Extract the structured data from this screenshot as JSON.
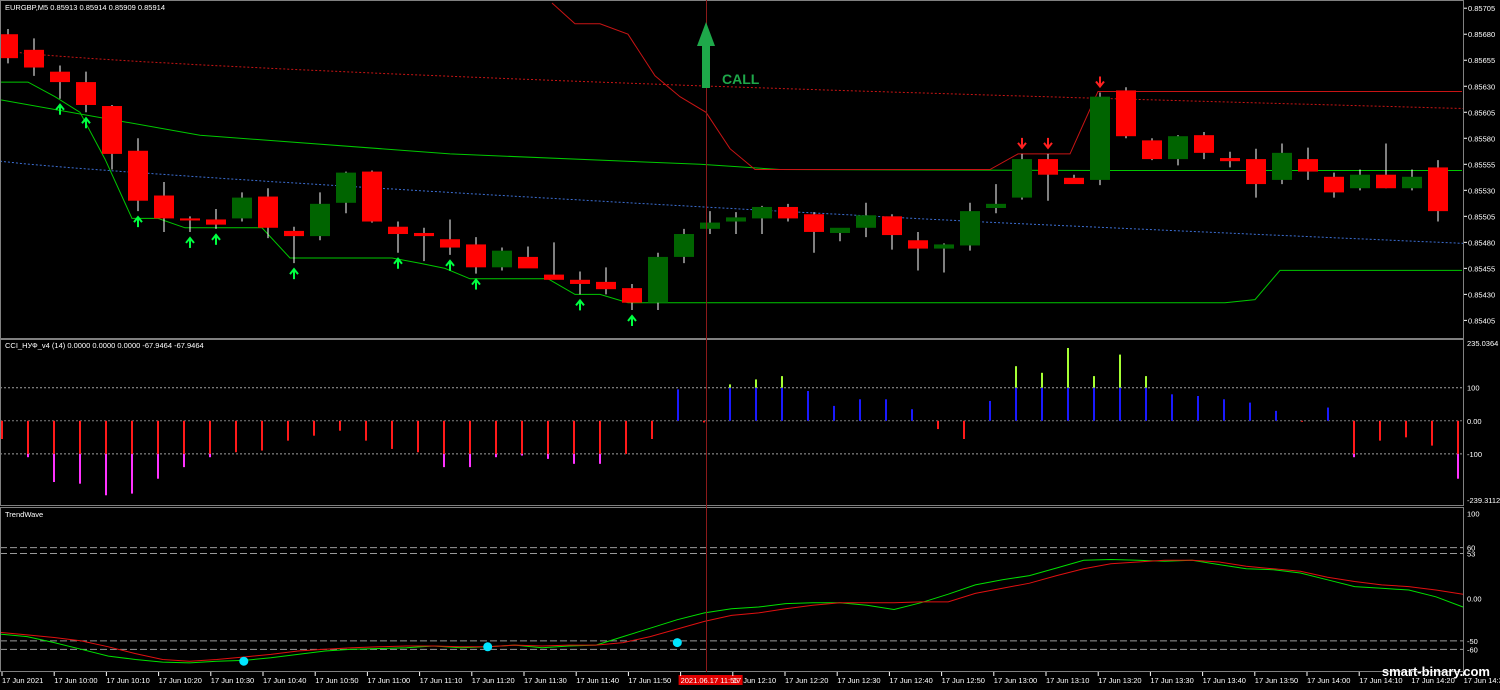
{
  "colors": {
    "background": "#000000",
    "bull_candle": "#006400",
    "bear_candle": "#ff0000",
    "wick": "#ffffff",
    "green_line": "#00c800",
    "red_line": "#c81414",
    "blue_dotted": "#3c6ed2",
    "up_arrow": "#00ff41",
    "down_arrow": "#ff2020",
    "cci_red": "#ff1a1a",
    "cci_magenta": "#ff33ff",
    "cci_blue": "#1a1aff",
    "cci_lime": "#a6ff33",
    "wave_green": "#00e000",
    "wave_red": "#e01010",
    "wave_dot": "#00e5ff",
    "call_arrow": "#1ea84a",
    "vline": "#8b1a1a",
    "panel_border": "#808080"
  },
  "panels": {
    "main": {
      "title": "EURGBP,M5  0.85913 0.85914 0.85909 0.85914",
      "signal_label": "CALL",
      "signal_icon": "up-arrow-icon"
    },
    "cci": {
      "title": "CCI_НУФ_v4 (14) 0.0000 0.0000 0.0000 -67.9464 -67.9464"
    },
    "trendwave": {
      "title": "TrendWave"
    }
  },
  "watermark": "smart-binary.com",
  "highlight_time_label": "2021.06.17 11:55",
  "chart_data": [
    {
      "type": "candlestick",
      "title": "EURGBP,M5  0.85913 0.85914 0.85909 0.85914",
      "ylim": [
        0.8539,
        0.8571
      ],
      "y_ticks": [
        "0.85705",
        "0.85680",
        "0.85655",
        "0.85630",
        "0.85605",
        "0.85580",
        "0.85555",
        "0.85530",
        "0.85505",
        "0.85480",
        "0.85455",
        "0.85430",
        "0.85405"
      ],
      "x_ticks": [
        "17 Jun 2021",
        "17 Jun 10:00",
        "17 Jun 10:10",
        "17 Jun 10:20",
        "17 Jun 10:30",
        "17 Jun 10:40",
        "17 Jun 10:50",
        "17 Jun 11:00",
        "17 Jun 11:10",
        "17 Jun 11:20",
        "17 Jun 11:30",
        "17 Jun 11:40",
        "17 Jun 11:50",
        "2021.06.17 11:55",
        "17 Jun 12:10",
        "17 Jun 12:20",
        "17 Jun 12:30",
        "17 Jun 12:40",
        "17 Jun 12:50",
        "17 Jun 13:00",
        "17 Jun 13:10",
        "17 Jun 13:20",
        "17 Jun 13:30",
        "17 Jun 13:40",
        "17 Jun 13:50",
        "17 Jun 14:00",
        "17 Jun 14:10",
        "17 Jun 14:20",
        "17 Jun 14:3"
      ],
      "candles": [
        [
          0.8568,
          0.85685,
          0.85652,
          0.85657
        ],
        [
          0.85665,
          0.85676,
          0.8564,
          0.85648
        ],
        [
          0.85644,
          0.8565,
          0.85618,
          0.85634
        ],
        [
          0.85634,
          0.85644,
          0.85605,
          0.85612
        ],
        [
          0.85611,
          0.85612,
          0.8555,
          0.85565
        ],
        [
          0.85568,
          0.8558,
          0.8551,
          0.8552
        ],
        [
          0.85525,
          0.85538,
          0.8549,
          0.85503
        ],
        [
          0.85503,
          0.85505,
          0.8549,
          0.85501
        ],
        [
          0.85502,
          0.85512,
          0.85493,
          0.85497
        ],
        [
          0.85503,
          0.85528,
          0.855,
          0.85523
        ],
        [
          0.85524,
          0.85532,
          0.85484,
          0.85494
        ],
        [
          0.85491,
          0.85495,
          0.8546,
          0.85486
        ],
        [
          0.85486,
          0.85528,
          0.85482,
          0.85517
        ],
        [
          0.85518,
          0.85548,
          0.85508,
          0.85547
        ],
        [
          0.85548,
          0.85549,
          0.85499,
          0.855
        ],
        [
          0.85495,
          0.855,
          0.8547,
          0.85488
        ],
        [
          0.85489,
          0.85494,
          0.85462,
          0.85486
        ],
        [
          0.85483,
          0.85502,
          0.85468,
          0.85475
        ],
        [
          0.85478,
          0.85485,
          0.8545,
          0.85456
        ],
        [
          0.85456,
          0.85475,
          0.85453,
          0.85472
        ],
        [
          0.85466,
          0.85476,
          0.85456,
          0.85455
        ],
        [
          0.85449,
          0.8548,
          0.85445,
          0.85444
        ],
        [
          0.85444,
          0.85452,
          0.8543,
          0.8544
        ],
        [
          0.85442,
          0.85456,
          0.8543,
          0.85435
        ],
        [
          0.85436,
          0.8544,
          0.85415,
          0.85422
        ],
        [
          0.85422,
          0.8547,
          0.85415,
          0.85466
        ],
        [
          0.85466,
          0.85493,
          0.8546,
          0.85488
        ],
        [
          0.85493,
          0.8551,
          0.85488,
          0.85499
        ],
        [
          0.855,
          0.85509,
          0.85488,
          0.85504
        ],
        [
          0.85503,
          0.85515,
          0.85488,
          0.85514
        ],
        [
          0.85514,
          0.85517,
          0.855,
          0.85503
        ],
        [
          0.85507,
          0.85509,
          0.8547,
          0.8549
        ],
        [
          0.85489,
          0.85492,
          0.85481,
          0.85494
        ],
        [
          0.85494,
          0.85518,
          0.85485,
          0.85506
        ],
        [
          0.85505,
          0.85507,
          0.85473,
          0.85487
        ],
        [
          0.85482,
          0.8549,
          0.85453,
          0.85474
        ],
        [
          0.85474,
          0.85479,
          0.85451,
          0.85478
        ],
        [
          0.85477,
          0.85518,
          0.85472,
          0.8551
        ],
        [
          0.85513,
          0.85536,
          0.85508,
          0.85517
        ],
        [
          0.85523,
          0.85565,
          0.85521,
          0.8556
        ],
        [
          0.8556,
          0.85565,
          0.8552,
          0.85545
        ],
        [
          0.85542,
          0.85545,
          0.85537,
          0.85536
        ],
        [
          0.8554,
          0.85624,
          0.85535,
          0.8562
        ],
        [
          0.85626,
          0.85629,
          0.8558,
          0.85582
        ],
        [
          0.85578,
          0.8558,
          0.85559,
          0.8556
        ],
        [
          0.8556,
          0.85583,
          0.85554,
          0.85582
        ],
        [
          0.85583,
          0.85586,
          0.8556,
          0.85566
        ],
        [
          0.85561,
          0.85567,
          0.85552,
          0.85558
        ],
        [
          0.8556,
          0.8557,
          0.85523,
          0.85536
        ],
        [
          0.8554,
          0.85575,
          0.85536,
          0.85566
        ],
        [
          0.8556,
          0.85571,
          0.8554,
          0.85548
        ],
        [
          0.85543,
          0.85547,
          0.85523,
          0.85528
        ],
        [
          0.85532,
          0.8555,
          0.8553,
          0.85545
        ],
        [
          0.85545,
          0.85575,
          0.85532,
          0.85532
        ],
        [
          0.85532,
          0.8555,
          0.8553,
          0.85543
        ],
        [
          0.85552,
          0.85559,
          0.855,
          0.8551
        ],
        [
          0.85515,
          0.85525,
          0.85505,
          0.85515
        ]
      ],
      "up_arrow_candles": [
        2,
        3,
        5,
        7,
        8,
        11,
        15,
        17,
        18,
        22,
        24
      ],
      "down_arrow_candles": [
        39,
        40,
        42
      ]
    },
    {
      "type": "bar",
      "title": "CCI_НУФ_v4 (14) 0.0000 0.0000 0.0000 -67.9464 -67.9464",
      "ylim": [
        -239.3112,
        235.0364
      ],
      "y_ticks": [
        "235.0364",
        "100",
        "0.00",
        "-100",
        "-239.3112"
      ],
      "levels": [
        100,
        -100
      ],
      "values": [
        -55,
        -110,
        -185,
        -190,
        -225,
        -220,
        -175,
        -140,
        -110,
        -95,
        -90,
        -60,
        -45,
        -30,
        -60,
        -85,
        -95,
        -140,
        -140,
        -110,
        -105,
        -115,
        -130,
        -130,
        -100,
        -55,
        95,
        -5,
        110,
        125,
        135,
        90,
        45,
        65,
        65,
        35,
        -25,
        -55,
        60,
        165,
        145,
        220,
        135,
        200,
        135,
        80,
        75,
        65,
        55,
        30,
        -3,
        40,
        -110,
        -60,
        -50,
        -75,
        -175,
        -170
      ]
    },
    {
      "type": "line",
      "title": "TrendWave",
      "ylim": [
        -82,
        102
      ],
      "y_ticks": [
        "100",
        "60",
        "53",
        "0.00",
        "-50",
        "-60"
      ],
      "levels": [
        60,
        53,
        -50,
        -60
      ],
      "series": [
        {
          "values": [
            -42,
            -45,
            -52,
            -60,
            -68,
            -72,
            -75,
            -76,
            -74,
            -73,
            -70,
            -66,
            -62,
            -60,
            -59,
            -58,
            -56,
            -58,
            -57,
            -55,
            -58,
            -56,
            -55,
            -45,
            -35,
            -25,
            -17,
            -12,
            -10,
            -6,
            -5,
            -5,
            -8,
            -13,
            -5,
            5,
            16,
            22,
            27,
            36,
            45,
            46,
            45,
            44,
            45,
            40,
            35,
            34,
            30,
            22,
            14,
            12,
            10,
            2,
            -10
          ]
        },
        {
          "values": [
            -40,
            -43,
            -46,
            -50,
            -57,
            -65,
            -72,
            -74,
            -72,
            -69,
            -66,
            -62,
            -60,
            -58,
            -57,
            -56,
            -56,
            -57,
            -57,
            -55,
            -56,
            -55,
            -55,
            -52,
            -45,
            -36,
            -27,
            -20,
            -17,
            -12,
            -8,
            -5,
            -5,
            -5,
            -4,
            -4,
            6,
            12,
            18,
            27,
            35,
            41,
            43,
            45,
            45,
            43,
            38,
            35,
            32,
            25,
            20,
            16,
            14,
            10,
            5
          ]
        }
      ],
      "dot_points": [
        [
          9,
          -74
        ],
        [
          18,
          -57
        ],
        [
          25,
          -52
        ]
      ]
    }
  ]
}
